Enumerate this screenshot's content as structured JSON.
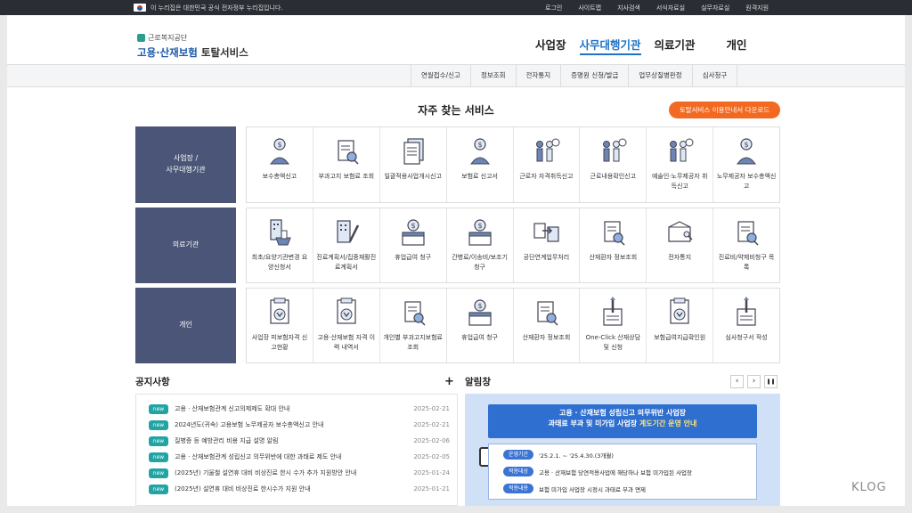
{
  "gov_bar": {
    "text": "이 누리집은 대한민국 공식 전자정부 누리집입니다.",
    "links": [
      "로그인",
      "사이트맵",
      "지사검색",
      "서식자료실",
      "실무자료실",
      "원격지원"
    ]
  },
  "logo": {
    "org": "근로복지공단",
    "service_main": "고용·산재보험",
    "service_sub": "토탈서비스"
  },
  "gnb": [
    "사업장",
    "사무대행기관",
    "의료기관",
    "개인"
  ],
  "subnav": [
    "연월접수/신고",
    "정보조회",
    "전자통지",
    "증명원 신청/발급",
    "업무상질병판정",
    "심사청구"
  ],
  "favorites": {
    "title": "자주 찾는 서비스",
    "download_button": "토탈서비스 이용안내서 다운로드",
    "rows": [
      {
        "head": [
          "사업장 /",
          "사무대행기관"
        ],
        "items": [
          {
            "label": "보수총액신고",
            "icon": "money-person-icon"
          },
          {
            "label": "부과고지 보험료 조회",
            "icon": "search-document-icon"
          },
          {
            "label": "일괄적용사업개시신고",
            "icon": "document-stack-icon"
          },
          {
            "label": "보험료 신고서",
            "icon": "money-person-icon"
          },
          {
            "label": "근로자 자격취득신고",
            "icon": "people-icon"
          },
          {
            "label": "근로내용확인신고",
            "icon": "people-icon"
          },
          {
            "label": "예술인·노무제공자 취득신고",
            "icon": "people-icon"
          },
          {
            "label": "노무제공자 보수총액신고",
            "icon": "money-person-icon"
          }
        ]
      },
      {
        "head": [
          "의료기관"
        ],
        "items": [
          {
            "label": "최초/요양기관변경 요양신청서",
            "icon": "building-vote-icon"
          },
          {
            "label": "진료계획서/집중재활진료계획서",
            "icon": "building-pen-icon"
          },
          {
            "label": "휴업급여 청구",
            "icon": "money-box-icon"
          },
          {
            "label": "간병료/이송비/보조기 청구",
            "icon": "money-box-icon"
          },
          {
            "label": "공단연계업무처리",
            "icon": "transfer-icon"
          },
          {
            "label": "산재환자 정보조회",
            "icon": "search-document-icon"
          },
          {
            "label": "전자통지",
            "icon": "package-icon"
          },
          {
            "label": "진료비/약제비청구 목록",
            "icon": "search-document-icon"
          }
        ]
      },
      {
        "head": [
          "개인"
        ],
        "items": [
          {
            "label": "사업장 피보험자격 신고현황",
            "icon": "download-doc-icon"
          },
          {
            "label": "고용·산재보험 자격 이력 내역서",
            "icon": "download-doc-icon"
          },
          {
            "label": "개인별 부과고지보험료 조회",
            "icon": "search-document-icon"
          },
          {
            "label": "휴업급여 청구",
            "icon": "money-box-icon"
          },
          {
            "label": "산재환자 정보조회",
            "icon": "search-document-icon"
          },
          {
            "label": "One-Click 산재상담 및 신청",
            "icon": "pen-document-icon"
          },
          {
            "label": "보험급여지급확인원",
            "icon": "download-doc-icon"
          },
          {
            "label": "심사청구서 작성",
            "icon": "pen-document-icon"
          }
        ]
      }
    ]
  },
  "notices": {
    "title": "공지사항",
    "more": "+",
    "badge": "new",
    "items": [
      {
        "text": "고용 · 산재보험관계 신고의제제도 확대 안내",
        "date": "2025-02-21"
      },
      {
        "text": "2024년도(귀속) 고용보험 노무제공자 보수총액신고 안내",
        "date": "2025-02-21"
      },
      {
        "text": "질병증 등 예방관리 비용 지급 설명 알림",
        "date": "2025-02-06"
      },
      {
        "text": "고용 · 산재보험관계 성립신고 의무위반에 대한 과태료 제도 안내",
        "date": "2025-02-05"
      },
      {
        "text": "(2025년) 기울철 설연휴 대비 비상진료 한시 수가 추가 지원방안 안내",
        "date": "2025-01-24"
      },
      {
        "text": "(2025년) 설연휴 대비 비상진료 한시수가 지원 안내",
        "date": "2025-01-21"
      }
    ]
  },
  "alarm": {
    "title": "알림창",
    "controls": [
      "‹",
      "›",
      "❚❚"
    ],
    "banner": {
      "line1": "고용 · 산재보험 성립신고 의무위반 사업장",
      "line2_a": "과태료 부과 및 미가입 사업장",
      "line2_b": "계도기간 운영 안내",
      "rows": [
        {
          "tag": "운영기간",
          "text": "'25.2.1. ~ '25.4.30.(3개월)"
        },
        {
          "tag": "적용대상",
          "text": "고용 · 산재보험 당연적용사업에 해당하나 보험 미가입된 사업장"
        },
        {
          "tag": "적용내용",
          "text": "보험 미가입 사업장 시정시 과태료 부과 면제"
        }
      ]
    }
  },
  "watermark": "KLOG",
  "colors": {
    "brand_blue": "#1e73c8",
    "row_head": "#4a5577",
    "accent_orange": "#f26a21",
    "badge_teal": "#23a3a3"
  }
}
